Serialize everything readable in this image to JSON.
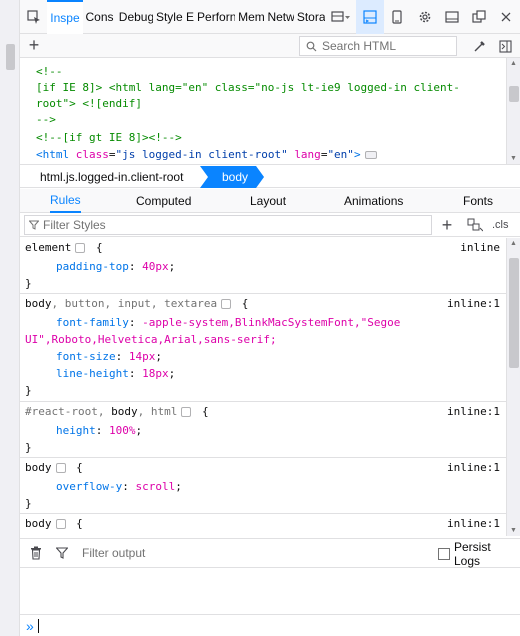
{
  "toolbar": {
    "tabs": [
      "Inspe",
      "Cons",
      "Debug",
      "Style E",
      "Perforn",
      "Mem",
      "Netw",
      "Stora"
    ],
    "active_tab": "Inspe"
  },
  "markup_bar": {
    "search_placeholder": "Search HTML"
  },
  "markup": {
    "lines": [
      {
        "kind": "comment",
        "text": "<!--"
      },
      {
        "kind": "comment",
        "text": "[if IE 8]> <html lang=\"en\" class=\"no-js lt-ie9 logged-in client-"
      },
      {
        "kind": "comment",
        "text": "root\"> <![endif]"
      },
      {
        "kind": "comment",
        "text": "-->"
      },
      {
        "kind": "comment",
        "text": "<!--[if gt IE 8]><!-->"
      }
    ],
    "html_tag": {
      "open": "<html",
      "attr1": "class",
      "val1": "\"js logged-in client-root\"",
      "attr2": "lang",
      "val2": "\"en\"",
      "close": ">"
    }
  },
  "breadcrumbs": {
    "items": [
      "html.js.logged-in.client-root",
      "body"
    ],
    "active": "body"
  },
  "sidebar_tabs": {
    "items": [
      "Rules",
      "Computed",
      "Layout",
      "Animations",
      "Fonts"
    ],
    "active": "Rules"
  },
  "filter_styles": {
    "placeholder": "Filter Styles",
    "cls_label": ".cls"
  },
  "rules": [
    {
      "selector": "element",
      "source": "inline",
      "decls": [
        {
          "prop": "padding-top",
          "value": "40px"
        }
      ]
    },
    {
      "selector": "body",
      "selector_rest": ", button, input, textarea",
      "source": "inline:1",
      "decls": [
        {
          "prop": "font-family",
          "value": "-apple-system,BlinkMacSystemFont,\"Segoe",
          "cont": "UI\",Roboto,Helvetica,Arial,sans-serif"
        },
        {
          "prop": "font-size",
          "value": "14px"
        },
        {
          "prop": "line-height",
          "value": "18px"
        }
      ]
    },
    {
      "selector_pre": "#react-root, ",
      "selector": "body",
      "selector_rest": ", html",
      "source": "inline:1",
      "decls": [
        {
          "prop": "height",
          "value": "100%"
        }
      ]
    },
    {
      "selector": "body",
      "source": "inline:1",
      "decls": [
        {
          "prop": "overflow-y",
          "value": "scroll"
        }
      ]
    },
    {
      "selector": "body",
      "source": "inline:1",
      "decls": []
    }
  ],
  "console": {
    "filter_placeholder": "Filter output",
    "persist_label": "Persist Logs",
    "prompt": "»"
  },
  "colors": {
    "accent": "#0a84ff",
    "comment": "#058b00",
    "property": "#0074e8",
    "value": "#dd00a9"
  }
}
